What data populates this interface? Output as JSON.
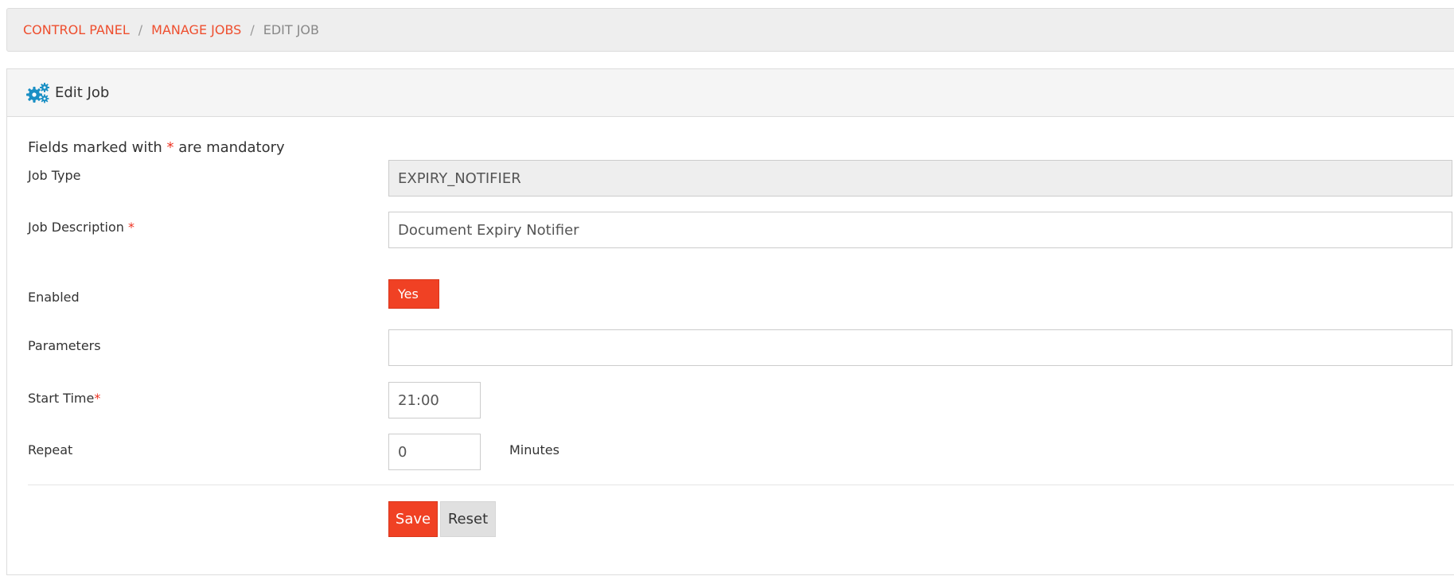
{
  "breadcrumb": {
    "items": [
      "CONTROL PANEL",
      "MANAGE JOBS"
    ],
    "separator": "/",
    "current": "EDIT JOB"
  },
  "panel": {
    "title": "Edit Job",
    "icon": "gears-icon"
  },
  "form": {
    "mandatory_note_prefix": "Fields marked with",
    "mandatory_marker": "*",
    "mandatory_note_suffix": "are mandatory",
    "job_type": {
      "label": "Job Type",
      "value": "EXPIRY_NOTIFIER"
    },
    "job_description": {
      "label": "Job Description",
      "required": "*",
      "value": "Document Expiry Notifier"
    },
    "enabled": {
      "label": "Enabled",
      "value": "Yes"
    },
    "parameters": {
      "label": "Parameters",
      "value": ""
    },
    "start_time": {
      "label": "Start Time",
      "required": "*",
      "value": "21:00"
    },
    "repeat": {
      "label": "Repeat",
      "value": "0",
      "unit": "Minutes"
    }
  },
  "actions": {
    "save_label": "Save",
    "reset_label": "Reset"
  },
  "colors": {
    "accent": "#f04124",
    "link": "#ee4e2e",
    "icon": "#1a8fc4"
  }
}
